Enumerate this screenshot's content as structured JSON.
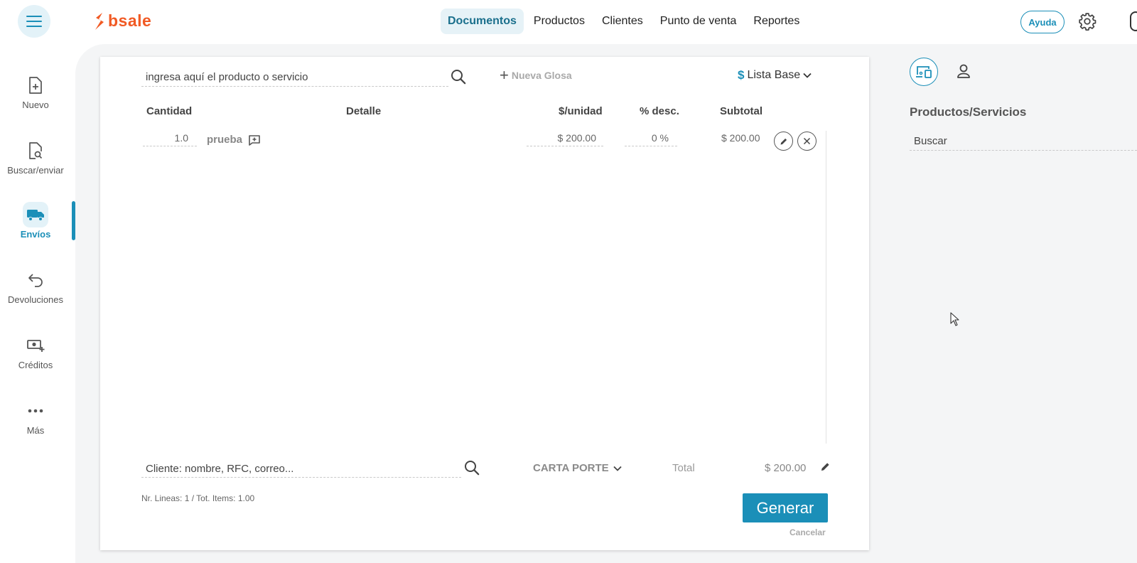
{
  "brand": {
    "name": "bsale",
    "color": "#f15a24"
  },
  "accent": "#1b8fb8",
  "nav": {
    "items": [
      {
        "label": "Documentos",
        "active": true
      },
      {
        "label": "Productos"
      },
      {
        "label": "Clientes"
      },
      {
        "label": "Punto de venta"
      },
      {
        "label": "Reportes"
      }
    ],
    "help_label": "Ayuda"
  },
  "sidebar": {
    "items": [
      {
        "label": "Nuevo",
        "icon": "file-plus-icon"
      },
      {
        "label": "Buscar/enviar",
        "icon": "file-search-icon"
      },
      {
        "label": "Envíos",
        "icon": "truck-icon",
        "active": true
      },
      {
        "label": "Devoluciones",
        "icon": "return-arrow-icon"
      },
      {
        "label": "Créditos",
        "icon": "cash-plus-icon"
      },
      {
        "label": "Más",
        "icon": "more-dots-icon"
      }
    ]
  },
  "document": {
    "product_search_placeholder": "ingresa aquí el producto o servicio",
    "new_gloss_label": "Nueva Glosa",
    "price_list_symbol": "$",
    "price_list_label": "Lista Base",
    "columns": {
      "quantity": "Cantidad",
      "detail": "Detalle",
      "unit_price": "$/unidad",
      "discount": "% desc.",
      "subtotal": "Subtotal"
    },
    "rows": [
      {
        "quantity": "1.0",
        "detail": "prueba",
        "unit_price": "$ 200.00",
        "discount": "0 %",
        "subtotal": "$ 200.00"
      }
    ],
    "client_search_placeholder": "Cliente: nombre, RFC, correo...",
    "doc_type_label": "CARTA PORTE",
    "total_label": "Total",
    "total_value": "$ 200.00",
    "lines_info": "Nr. Lineas: 1 / Tot. Items: 1.00",
    "generate_label": "Generar",
    "cancel_label": "Cancelar"
  },
  "right_panel": {
    "title": "Productos/Servicios",
    "search_placeholder": "Buscar"
  }
}
